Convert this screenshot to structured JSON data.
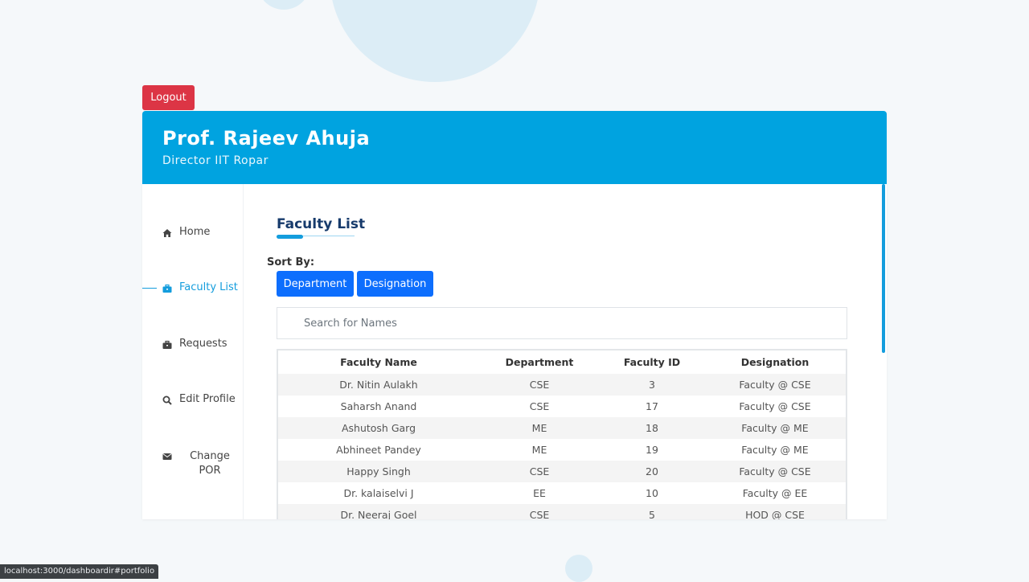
{
  "header": {
    "name": "Prof. Rajeev Ahuja",
    "role": "Director IIT Ropar",
    "logout_label": "Logout"
  },
  "sidebar": {
    "items": [
      {
        "label": "Home",
        "icon": "home-icon"
      },
      {
        "label": "Faculty List",
        "icon": "briefcase-icon",
        "active": true
      },
      {
        "label": "Requests",
        "icon": "briefcase-icon"
      },
      {
        "label": "Edit Profile",
        "icon": "search-icon"
      },
      {
        "label_line1": "Change",
        "label_line2": "POR",
        "icon": "envelope-icon"
      }
    ]
  },
  "main": {
    "section_title": "Faculty List",
    "sort_label": "Sort By:",
    "sort_buttons": [
      "Department",
      "Designation"
    ],
    "search": {
      "placeholder": "Search for Names",
      "value": ""
    },
    "table": {
      "headers": [
        "Faculty Name",
        "Department",
        "Faculty ID",
        "Designation"
      ],
      "rows": [
        [
          "Dr. Nitin Aulakh",
          "CSE",
          "3",
          "Faculty @ CSE"
        ],
        [
          "Saharsh Anand",
          "CSE",
          "17",
          "Faculty @ CSE"
        ],
        [
          "Ashutosh Garg",
          "ME",
          "18",
          "Faculty @ ME"
        ],
        [
          "Abhineet Pandey",
          "ME",
          "19",
          "Faculty @ ME"
        ],
        [
          "Happy Singh",
          "CSE",
          "20",
          "Faculty @ CSE"
        ],
        [
          "Dr. kalaiselvi J",
          "EE",
          "10",
          "Faculty @ EE"
        ],
        [
          "Dr. Neeraj Goel",
          "CSE",
          "5",
          "HOD @ CSE"
        ]
      ]
    }
  },
  "status_url": "localhost:3000/dashboardir#portfolio",
  "colors": {
    "header_bg": "#00a3e0",
    "accent": "#149ddd",
    "button_bg": "#0d6efd",
    "logout_bg": "#dc3545"
  }
}
